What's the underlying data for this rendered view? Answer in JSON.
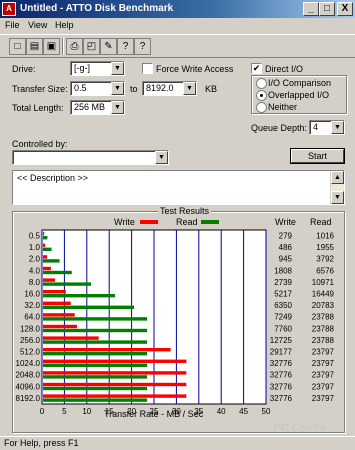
{
  "window": {
    "title": "Untitled - ATTO Disk Benchmark",
    "minimize": "_",
    "maximize": "□",
    "close": "X"
  },
  "menu": [
    "File",
    "View",
    "Help"
  ],
  "toolbar": [
    {
      "name": "new-icon",
      "glyph": "□"
    },
    {
      "name": "open-icon",
      "glyph": "▤"
    },
    {
      "name": "save-icon",
      "glyph": "▣"
    },
    {
      "name": "print-icon",
      "glyph": "⎙"
    },
    {
      "name": "print-preview-icon",
      "glyph": "◰"
    },
    {
      "name": "wrench-icon",
      "glyph": "✎"
    },
    {
      "name": "help-icon",
      "glyph": "?"
    },
    {
      "name": "context-help-icon",
      "glyph": "?"
    }
  ],
  "form": {
    "drive_label": "Drive:",
    "drive_value": "[-g-]",
    "force_write_label": "Force Write Access",
    "direct_io_label": "Direct I/O",
    "direct_io_checked": "✔",
    "transfer_size_label": "Transfer Size:",
    "transfer_from": "0.5",
    "to_label": "to",
    "transfer_to": "8192.0",
    "kb_label": "KB",
    "total_length_label": "Total Length:",
    "total_length_value": "256 MB",
    "io_options": [
      "I/O Comparison",
      "Overlapped I/O",
      "Neither"
    ],
    "io_selected": "Overlapped I/O",
    "queue_depth_label": "Queue Depth:",
    "queue_depth_value": "4",
    "controlled_by_label": "Controlled by:",
    "controlled_by_value": "",
    "start_button": "Start",
    "description": "<< Description >>"
  },
  "results": {
    "group_title": "Test Results",
    "write_legend": "Write",
    "read_legend": "Read",
    "write_col": "Write",
    "read_col": "Read",
    "write_color": "#ff0000",
    "read_color": "#008000"
  },
  "chart_data": {
    "type": "bar",
    "orientation": "horizontal",
    "title": "Test Results",
    "xlabel": "Transfer Rate - MB / Sec",
    "xlim": [
      0,
      50
    ],
    "xticks": [
      "0",
      "5",
      "10",
      "15",
      "20",
      "25",
      "30",
      "35",
      "40",
      "45",
      "50"
    ],
    "categories": [
      "0.5",
      "1.0",
      "2.0",
      "4.0",
      "8.0",
      "16.0",
      "32.0",
      "64.0",
      "128.0",
      "256.0",
      "512.0",
      "1024.0",
      "2048.0",
      "4096.0",
      "8192.0"
    ],
    "series": [
      {
        "name": "Write",
        "color": "#ff0000",
        "values": [
          0.27,
          0.47,
          0.92,
          1.77,
          2.67,
          5.09,
          6.2,
          7.08,
          7.58,
          12.43,
          28.49,
          32.0,
          32.0,
          32.0,
          32.0
        ]
      },
      {
        "name": "Read",
        "color": "#008000",
        "values": [
          0.99,
          1.91,
          3.7,
          6.42,
          10.71,
          16.06,
          20.31,
          23.23,
          23.23,
          23.23,
          23.24,
          23.24,
          23.24,
          23.24,
          23.24
        ]
      }
    ],
    "write_kb": [
      "279",
      "486",
      "945",
      "1808",
      "2739",
      "5217",
      "6350",
      "7249",
      "7760",
      "12725",
      "29177",
      "32776",
      "32776",
      "32776",
      "32776"
    ],
    "read_kb": [
      "1016",
      "1955",
      "3792",
      "6576",
      "10971",
      "16449",
      "20783",
      "23788",
      "23788",
      "23788",
      "23797",
      "23797",
      "23797",
      "23797",
      "23797"
    ],
    "grid": true
  },
  "status": {
    "text": "For Help, press F1",
    "watermark": "PC Centre"
  }
}
